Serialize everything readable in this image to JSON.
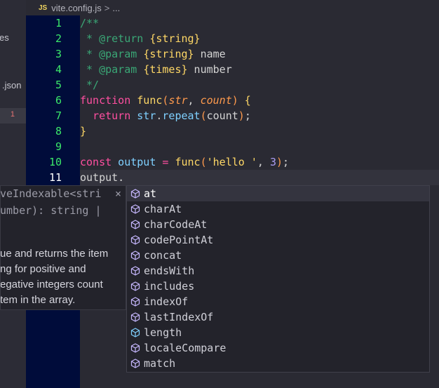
{
  "breadcrumb": {
    "file_icon": "JS",
    "file": "vite.config.js",
    "separator": ">",
    "more": "..."
  },
  "sidebar": {
    "items": [
      {
        "label": "es"
      },
      {
        "label": ".json"
      }
    ],
    "badge": "1"
  },
  "gutter": {
    "lines": [
      "1",
      "2",
      "3",
      "4",
      "5",
      "6",
      "7",
      "8",
      "9",
      "10",
      "11"
    ]
  },
  "code": {
    "l1": "/**",
    "l2_pre": " * ",
    "l2_tag": "@return",
    "l2_sp": " ",
    "l2_type": "{string}",
    "l3_pre": " * ",
    "l3_tag": "@param",
    "l3_sp": " ",
    "l3_type": "{string}",
    "l3_name": " name",
    "l4_pre": " * ",
    "l4_tag": "@param",
    "l4_sp": " ",
    "l4_type": "{times}",
    "l4_name": " number",
    "l5": " */",
    "l6_kw": "function",
    "l6_sp": " ",
    "l6_fn": "func",
    "l6_p1": "(",
    "l6_a1": "str",
    "l6_comma": ", ",
    "l6_a2": "count",
    "l6_p2": ")",
    "l6_brace": " {",
    "l7_indent": "  ",
    "l7_kw": "return",
    "l7_sp": " ",
    "l7_obj": "str",
    "l7_dot": ".",
    "l7_fn": "repeat",
    "l7_p1": "(",
    "l7_arg": "count",
    "l7_p2": ")",
    "l7_semi": ";",
    "l8": "}",
    "l10_kw": "const",
    "l10_var": " output",
    "l10_eq": " = ",
    "l10_fn": "func",
    "l10_p1": "(",
    "l10_str": "'hello '",
    "l10_comma": ", ",
    "l10_num": "3",
    "l10_p2": ")",
    "l10_semi": ";",
    "l11": "output."
  },
  "doc": {
    "sig1": "veIndexable<stri",
    "close": "×",
    "sig2": "umber): string |",
    "text1": "ue and returns the item",
    "text2": "ng for positive and",
    "text3": "egative integers count",
    "text4": "tem in the array."
  },
  "suggestions": [
    {
      "label": "at",
      "icon": "method-cube-icon"
    },
    {
      "label": "charAt",
      "icon": "method-cube-icon"
    },
    {
      "label": "charCodeAt",
      "icon": "method-cube-icon"
    },
    {
      "label": "codePointAt",
      "icon": "method-cube-icon"
    },
    {
      "label": "concat",
      "icon": "method-cube-icon"
    },
    {
      "label": "endsWith",
      "icon": "method-cube-icon"
    },
    {
      "label": "includes",
      "icon": "method-cube-icon"
    },
    {
      "label": "indexOf",
      "icon": "method-cube-icon"
    },
    {
      "label": "lastIndexOf",
      "icon": "method-cube-icon"
    },
    {
      "label": "length",
      "icon": "property-cube-icon"
    },
    {
      "label": "localeCompare",
      "icon": "method-cube-icon"
    },
    {
      "label": "match",
      "icon": "method-cube-icon"
    }
  ],
  "colors": {
    "gutter_bg": "#000c3a",
    "line_numbers": "#3be86a",
    "editor_bg": "#2a2a33",
    "selected_item": "#34343f"
  }
}
